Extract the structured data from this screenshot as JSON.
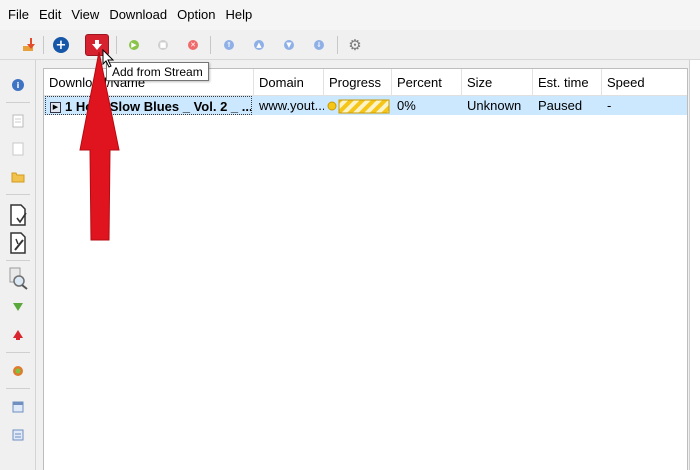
{
  "menu": [
    "File",
    "Edit",
    "View",
    "Download",
    "Option",
    "Help"
  ],
  "toolbar": {
    "tooltip": "Add from Stream"
  },
  "table": {
    "columns": [
      "Download/Name",
      "Domain",
      "Progress",
      "Percent",
      "Size",
      "Est. time",
      "Speed"
    ],
    "rows": [
      {
        "name": "1 Hour Slow Blues _ Vol. 2 _ ...",
        "domain": "www.yout...",
        "progress": 0,
        "percent": "0%",
        "size": "Unknown",
        "est_time": "Paused",
        "speed": "-"
      }
    ]
  },
  "colors": {
    "selection": "#cce8ff",
    "stream_button": "#d6212f",
    "add_button": "#1757a8",
    "arrow": "#e0141e",
    "progress_stripe": "#f5c518"
  }
}
